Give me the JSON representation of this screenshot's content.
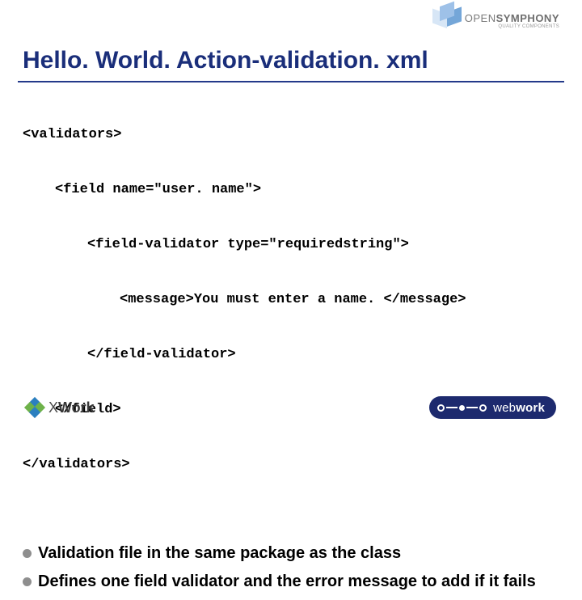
{
  "header": {
    "brand_main_light": "OPEN",
    "brand_main_bold": "SYMPHONY",
    "brand_sub": "QUALITY COMPONENTS"
  },
  "title": "Hello. World. Action-validation. xml",
  "code": {
    "l1": "<validators>",
    "l2": "<field name=\"user. name\">",
    "l3": "<field-validator type=\"requiredstring\">",
    "l4": "<message>You must enter a name. </message>",
    "l5": "</field-validator>",
    "l6": "</field>",
    "l7": "</validators>"
  },
  "bullets": {
    "b1": "Validation file in the same package as the class",
    "b2": "Defines one field validator and the error message to add if it fails"
  },
  "footer": {
    "xwork_x": "X",
    "xwork_w": "Work",
    "webwork_pre": "web",
    "webwork_bold": "work"
  }
}
